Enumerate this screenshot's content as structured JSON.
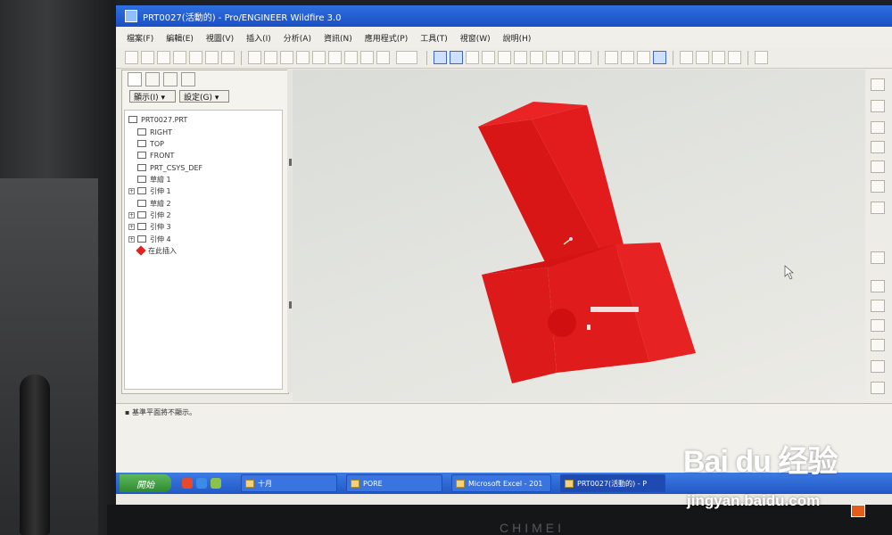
{
  "window": {
    "title": "PRT0027(活動的) - Pro/ENGINEER Wildfire 3.0"
  },
  "menu": [
    "檔案(F)",
    "編輯(E)",
    "視圖(V)",
    "插入(I)",
    "分析(A)",
    "資訊(N)",
    "應用程式(P)",
    "工具(T)",
    "視窗(W)",
    "說明(H)"
  ],
  "model_tree": {
    "display_dropdown": "顯示(I) ▾",
    "settings_dropdown": "設定(G) ▾",
    "items": [
      {
        "label": "PRT0027.PRT",
        "icon": "part-icon"
      },
      {
        "label": "RIGHT",
        "icon": "datum-plane-icon"
      },
      {
        "label": "TOP",
        "icon": "datum-plane-icon"
      },
      {
        "label": "FRONT",
        "icon": "datum-plane-icon"
      },
      {
        "label": "PRT_CSYS_DEF",
        "icon": "csys-icon"
      },
      {
        "label": "草繪 1",
        "icon": "sketch-icon"
      },
      {
        "label": "引伸 1",
        "icon": "extrude-icon"
      },
      {
        "label": "草繪 2",
        "icon": "sketch-icon"
      },
      {
        "label": "引伸 2",
        "icon": "extrude-icon"
      },
      {
        "label": "引伸 3",
        "icon": "extrude-icon"
      },
      {
        "label": "引伸 4",
        "icon": "extrude-icon"
      },
      {
        "label": "在此插入",
        "icon": "insert-here-icon"
      }
    ]
  },
  "model": {
    "color": "#e21c1c",
    "shade_dark": "#c41212",
    "shade_light": "#ee2a2a",
    "background": "#e0e1dc"
  },
  "message": "▪ 基準平面將不顯示。",
  "taskbar": {
    "start_label": "開始",
    "tasks": [
      "十月",
      "PORE",
      "Microsoft Excel - 201",
      "PRT0027(活動的) - P"
    ]
  },
  "watermark": {
    "logo": "Bai du 经验",
    "url": "jingyan.baidu.com"
  },
  "monitor_brand": "CHIMEI"
}
